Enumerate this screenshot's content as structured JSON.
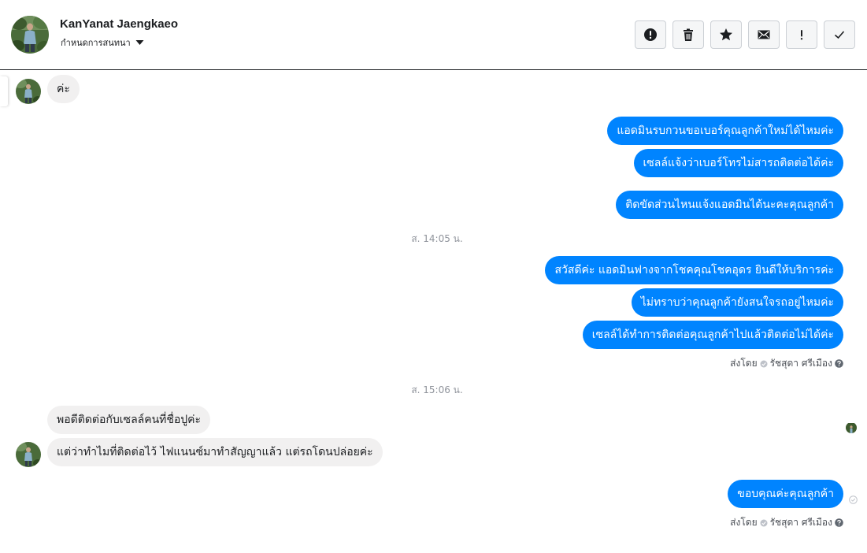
{
  "header": {
    "name": "KanYanat Jaengkaeo",
    "subtitle": "กำหนดการสนทนา",
    "actions": [
      {
        "icon": "alert-circle-icon"
      },
      {
        "icon": "trash-icon"
      },
      {
        "icon": "star-icon"
      },
      {
        "icon": "envelope-icon"
      },
      {
        "icon": "exclamation-icon"
      },
      {
        "icon": "checkmark-icon"
      }
    ]
  },
  "colors": {
    "outgoing_bubble": "#0084ff",
    "incoming_bubble": "#f1f0f0",
    "timestamp_text": "#90949c"
  },
  "messages": {
    "m1": "ค่ะ",
    "m2": "แอดมินรบกวนขอเบอร์คุณลูกค้าใหม่ได้ไหมค่ะ",
    "m3": "เซลล์แจ้งว่าเบอร์โทรไม่สารถติดต่อได้ค่ะ",
    "m4": "ติดขัดส่วนไหนแจ้งแอดมินได้นะคะคุณลูกค้า",
    "m5": "สวัสดีค่ะ แอดมินฟางจากโชคคุณโชคอุดร ยินดีให้บริการค่ะ",
    "m6": "ไม่ทราบว่าคุณลูกค้ายังสนใจรถอยู่ไหมค่ะ",
    "m7": "เซลล์ได้ทำการติดต่อคุณลูกค้าไปแล้วติดต่อไม่ได้ค่ะ",
    "m8": "พอดีติดต่อกับเซลล์คนที่ชื่อปูค่ะ",
    "m9": "แต่ว่าทำไมที่ติดต่อไว้ ไฟแนนซ์มาทำสัญญาแล้ว แต่รถโดนปล่อยค่ะ",
    "m10": "ขอบคุณค่ะคุณลูกค้า"
  },
  "timestamps": {
    "t1": "ส. 14:05 น.",
    "t2": "ส. 15:06 น."
  },
  "sent_by": {
    "label": "ส่งโดย",
    "name": "รัชสุดา ศรีเมือง"
  }
}
